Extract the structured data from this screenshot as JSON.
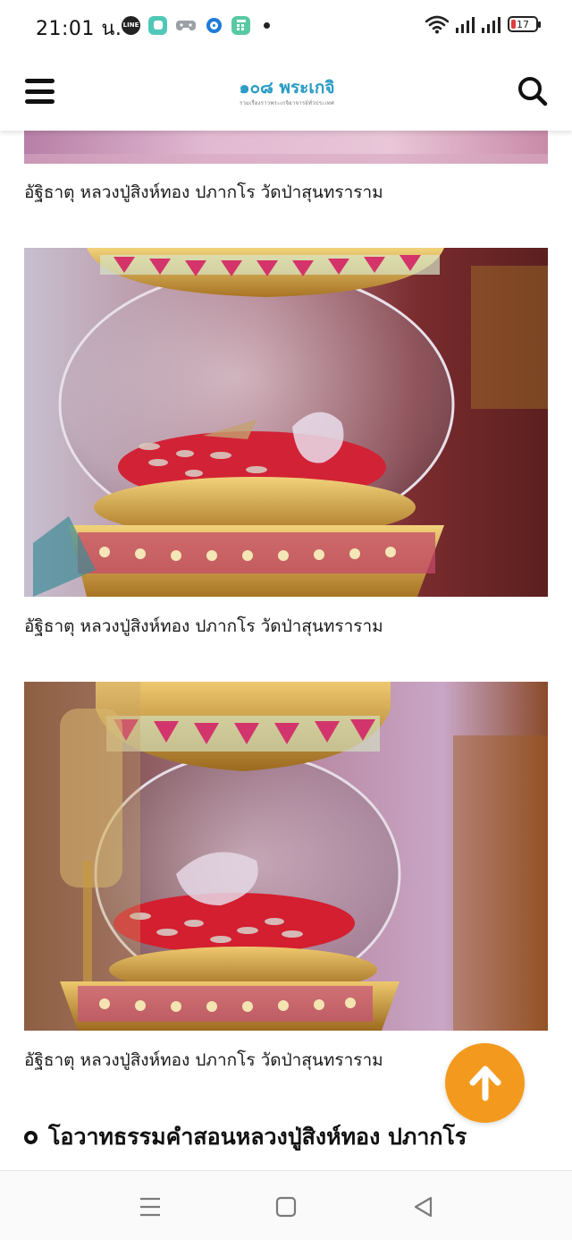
{
  "status_bar": {
    "time": "21:01 น.",
    "notification_icons": [
      "line-app-icon",
      "teal-app-icon",
      "game-controller-icon",
      "blue-circle-app-icon",
      "green-calculator-icon",
      "more-dot-icon"
    ],
    "line_label": "LINE",
    "battery_level": "17"
  },
  "header": {
    "menu_icon": "hamburger-menu-icon",
    "logo_title": "๑๐๘ พระเกจิ",
    "logo_subtitle": "รวมเรื่องราวพระเกจิอาจารย์ทั่วประเทศ",
    "search_icon": "search-icon"
  },
  "gallery": {
    "items": [
      {
        "caption": "อัฐิธาตุ หลวงปู่สิงห์ทอง ปภากโร วัดป่าสุนทราราม"
      },
      {
        "caption": "อัฐิธาตุ หลวงปู่สิงห์ทอง ปภากโร วัดป่าสุนทราราม"
      },
      {
        "caption": "อัฐิธาตุ หลวงปู่สิงห์ทอง ปภากโร วัดป่าสุนทราราม"
      }
    ]
  },
  "section": {
    "heading": "โอวาทธรรมคำสอนหลวงปู่สิงห์ทอง ปภากโร"
  },
  "scroll_top": {
    "icon": "arrow-up-icon",
    "color": "#f39a1e"
  },
  "nav_bar": {
    "recents_icon": "recent-apps-icon",
    "home_icon": "home-icon",
    "back_icon": "back-icon"
  },
  "colors": {
    "accent": "#f39a1e",
    "logo": "#2a9bc4",
    "battery_low": "#e23b3b"
  }
}
